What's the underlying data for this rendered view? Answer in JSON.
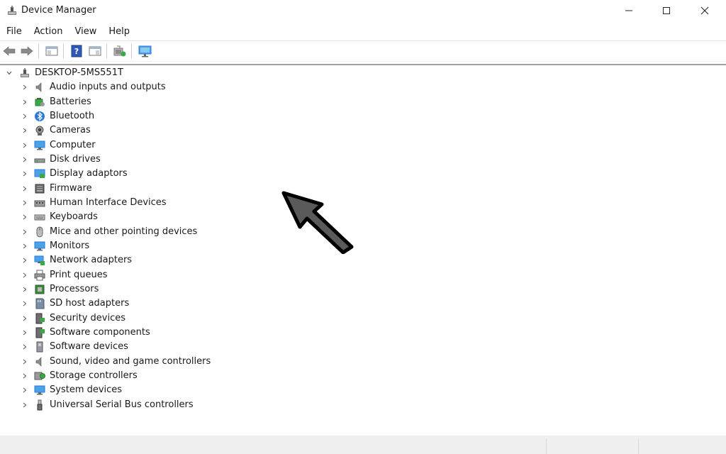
{
  "window": {
    "title": "Device Manager"
  },
  "menu": [
    "File",
    "Action",
    "View",
    "Help"
  ],
  "tree": {
    "root": "DESKTOP-5MS551T",
    "items": [
      {
        "label": "Audio inputs and outputs",
        "icon": "speaker-icon"
      },
      {
        "label": "Batteries",
        "icon": "battery-icon"
      },
      {
        "label": "Bluetooth",
        "icon": "bluetooth-icon"
      },
      {
        "label": "Cameras",
        "icon": "camera-icon"
      },
      {
        "label": "Computer",
        "icon": "computer-icon"
      },
      {
        "label": "Disk drives",
        "icon": "disk-drive-icon"
      },
      {
        "label": "Display adaptors",
        "icon": "display-adapter-icon"
      },
      {
        "label": "Firmware",
        "icon": "firmware-icon"
      },
      {
        "label": "Human Interface Devices",
        "icon": "hid-icon"
      },
      {
        "label": "Keyboards",
        "icon": "keyboard-icon"
      },
      {
        "label": "Mice and other pointing devices",
        "icon": "mouse-icon"
      },
      {
        "label": "Monitors",
        "icon": "monitor-icon"
      },
      {
        "label": "Network adapters",
        "icon": "network-adapter-icon"
      },
      {
        "label": "Print queues",
        "icon": "printer-icon"
      },
      {
        "label": "Processors",
        "icon": "processor-icon"
      },
      {
        "label": "SD host adapters",
        "icon": "sd-card-icon"
      },
      {
        "label": "Security devices",
        "icon": "security-device-icon"
      },
      {
        "label": "Software components",
        "icon": "software-component-icon"
      },
      {
        "label": "Software devices",
        "icon": "software-device-icon"
      },
      {
        "label": "Sound, video and game controllers",
        "icon": "sound-controller-icon"
      },
      {
        "label": "Storage controllers",
        "icon": "storage-controller-icon"
      },
      {
        "label": "System devices",
        "icon": "system-device-icon"
      },
      {
        "label": "Universal Serial Bus controllers",
        "icon": "usb-icon"
      }
    ]
  },
  "colors": {
    "accent_blue": "#2b79d6",
    "monitor_blue": "#4aa3e8",
    "green": "#3aa845"
  }
}
